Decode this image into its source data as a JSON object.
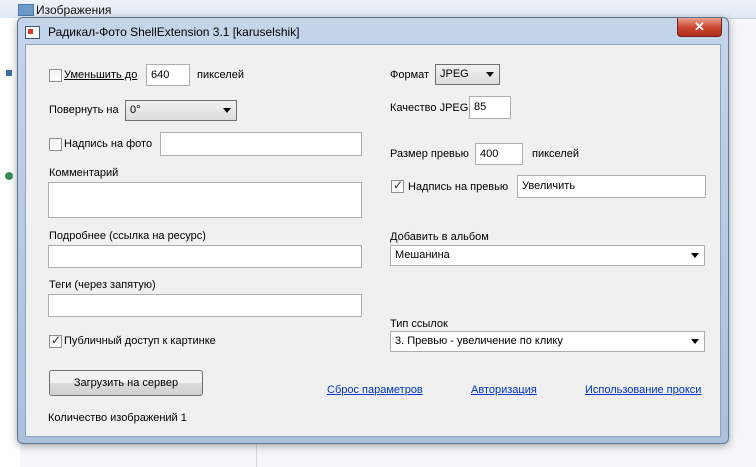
{
  "background": {
    "explorer_title": "Изображения"
  },
  "window": {
    "title": "Радикал-Фото ShellExtension 3.1 [karuselshik]",
    "close_symbol": "✕"
  },
  "left": {
    "resize_label": "Уменьшить до",
    "resize_value": "640",
    "resize_unit": "пикселей",
    "resize_checked": false,
    "rotate_label": "Повернуть на",
    "rotate_value": "0°",
    "caption_label": "Надпись на фото",
    "caption_checked": false,
    "caption_value": "",
    "comment_label": "Комментарий",
    "comment_value": "",
    "more_label": "Подробнее (ссылка на ресурс)",
    "more_value": "",
    "tags_label": "Теги (через запятую)",
    "tags_value": "",
    "public_label": "Публичный доступ к картинке",
    "public_checked": true,
    "upload_button": "Загрузить на сервер",
    "count_label": "Количество изображений 1"
  },
  "right": {
    "format_label": "Формат",
    "format_value": "JPEG",
    "quality_label": "Качество JPEG",
    "quality_value": "85",
    "preview_size_label": "Размер превью",
    "preview_size_value": "400",
    "preview_size_unit": "пикселей",
    "preview_caption_label": "Надпись на превью",
    "preview_caption_checked": true,
    "preview_caption_value": "Увеличить",
    "album_label": "Добавить в альбом",
    "album_value": "Мешанина",
    "link_type_label": "Тип ссылок",
    "link_type_value": "3. Превью - увеличение по клику"
  },
  "links": {
    "reset": "Сброс параметров",
    "auth": "Авторизация",
    "proxy": "Использование прокси"
  }
}
